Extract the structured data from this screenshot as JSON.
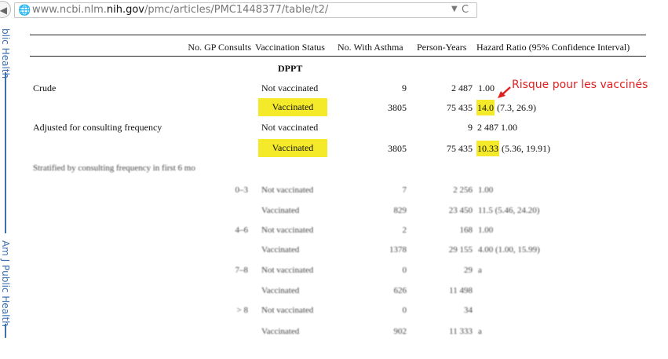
{
  "browser": {
    "url_prefix": "www.ncbi.nlm.",
    "url_domain": "nih.gov",
    "url_path": "/pmc/articles/PMC1448377/table/t2/"
  },
  "sidebar": {
    "label_top": "blic Health",
    "label_bottom": "Am J Public Health"
  },
  "table": {
    "headers": [
      "No. GP Consults",
      "Vaccination Status",
      "No. With Asthma",
      "Person-Years",
      "Hazard Ratio (95% Confidence Interval)"
    ],
    "section": "DPPT",
    "crude": {
      "label": "Crude",
      "not_vacc": {
        "status": "Not vaccinated",
        "asthma": "9",
        "py": "2 487",
        "hr": "1.00"
      },
      "vacc": {
        "status": "Vaccinated",
        "asthma": "3805",
        "py": "75 435",
        "hr_main": "14.0",
        "hr_ci": "(7.3, 26.9)"
      }
    },
    "adjusted": {
      "label": "Adjusted for consulting frequency",
      "not_vacc": {
        "status": "Not vaccinated",
        "asthma": "9",
        "py_hr": "2 487 1.00"
      },
      "vacc": {
        "status": "Vaccinated",
        "asthma": "3805",
        "py": "75 435",
        "hr_main": "10.33",
        "hr_ci": "(5.36, 19.91)"
      }
    },
    "stratified": {
      "label": "Stratified by consulting frequency in first 6 mo",
      "rows": [
        {
          "group": "0–3",
          "status": "Not vaccinated",
          "asthma": "7",
          "py": "2 256",
          "hr": "1.00"
        },
        {
          "group": "",
          "status": "Vaccinated",
          "asthma": "829",
          "py": "23 450",
          "hr": "11.5 (5.46, 24.20)"
        },
        {
          "group": "4–6",
          "status": "Not vaccinated",
          "asthma": "2",
          "py": "168",
          "hr": "1.00"
        },
        {
          "group": "",
          "status": "Vaccinated",
          "asthma": "1378",
          "py": "29 155",
          "hr": "4.00 (1.00, 15.99)"
        },
        {
          "group": "7–8",
          "status": "Not vaccinated",
          "asthma": "0",
          "py": "29",
          "hr": "a"
        },
        {
          "group": "",
          "status": "Vaccinated",
          "asthma": "626",
          "py": "11 498",
          "hr": ""
        },
        {
          "group": "> 8",
          "status": "Not vaccinated",
          "asthma": "0",
          "py": "34",
          "hr": ""
        },
        {
          "group": "",
          "status": "Vaccinated",
          "asthma": "902",
          "py": "11 333",
          "hr": "a"
        }
      ]
    }
  },
  "annotation": {
    "text": "Risque pour les vaccinés",
    "color": "#e02020"
  },
  "colors": {
    "highlight": "#f5ea2a",
    "sidebar_blue": "#3c6fae"
  }
}
